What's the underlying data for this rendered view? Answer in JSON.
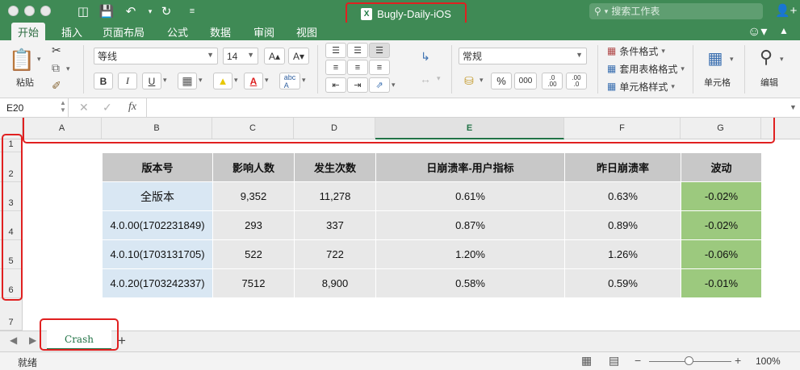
{
  "window": {
    "title": "Bugly-Daily-iOS",
    "file_badge": "X"
  },
  "search": {
    "placeholder": "搜索工作表"
  },
  "tabs": [
    "开始",
    "插入",
    "页面布局",
    "公式",
    "数据",
    "审阅",
    "视图"
  ],
  "ribbon": {
    "paste_label": "粘贴",
    "font_name": "等线",
    "font_size": "14",
    "grow_font": "A▴",
    "shrink_font": "A▾",
    "bold": "B",
    "italic": "I",
    "underline": "U",
    "number_format": "常规",
    "percent": "%",
    "thousands": "000",
    "inc_decimal": ".0\n.00",
    "dec_decimal": ".00\n.0",
    "conditional_format": "条件格式",
    "table_format": "套用表格格式",
    "cell_style": "单元格样式",
    "cells_label": "单元格",
    "editing_label": "编辑"
  },
  "formula_bar": {
    "cell_ref": "E20",
    "fx": "fx",
    "content": ""
  },
  "columns": [
    "A",
    "B",
    "C",
    "D",
    "E",
    "F",
    "G"
  ],
  "selected_column": "E",
  "rows": [
    "1",
    "2",
    "3",
    "4",
    "5",
    "6",
    "7"
  ],
  "table": {
    "headers": [
      "版本号",
      "影响人数",
      "发生次数",
      "日崩溃率-用户指标",
      "昨日崩溃率",
      "波动"
    ],
    "rows": [
      [
        "全版本",
        "9,352",
        "11,278",
        "0.61%",
        "0.63%",
        "-0.02%"
      ],
      [
        "4.0.00(1702231849)",
        "293",
        "337",
        "0.87%",
        "0.89%",
        "-0.02%"
      ],
      [
        "4.0.10(1703131705)",
        "522",
        "722",
        "1.20%",
        "1.26%",
        "-0.06%"
      ],
      [
        "4.0.20(1703242337)",
        "7512",
        "8,900",
        "0.58%",
        "0.59%",
        "-0.01%"
      ]
    ]
  },
  "sheets": [
    "Crash"
  ],
  "status": {
    "text": "就绪",
    "zoom": "100%"
  },
  "colors": {
    "excel_green": "#217346",
    "title_bar": "#3f8a55",
    "highlight_red": "#e02020",
    "positive_fill": "#9cc97e",
    "version_fill": "#d9e7f3"
  }
}
